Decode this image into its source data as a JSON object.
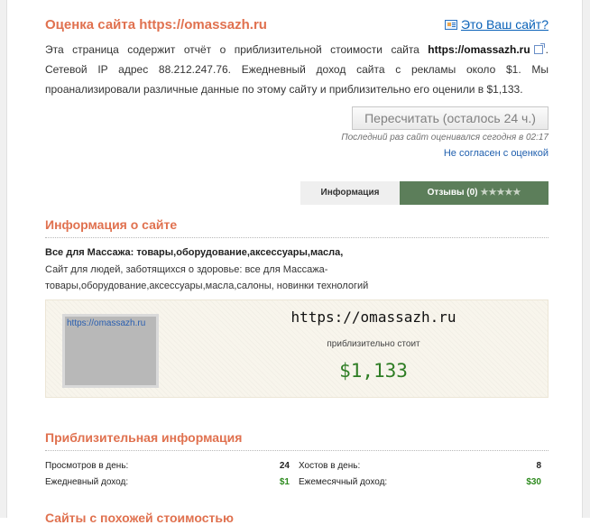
{
  "header": {
    "title": "Оценка сайта https://omassazh.ru",
    "owner_link": "Это Ваш сайт?"
  },
  "description": {
    "part1": "Эта страница содержит отчёт о приблизительной стоимости сайта ",
    "domain": "https://omassazh.ru",
    "part2": ". Сетевой IP адрес 88.212.247.76. Ежедневный доход сайта с рекламы около $1. Мы проанализировали различные данные по этому сайту и приблизительно его оценили в $1,133."
  },
  "recalc": {
    "button_label": "Пересчитать (осталось 24 ч.)",
    "last_evaluated": "Последний раз сайт оценивался сегодня в 02:17",
    "disagree_link": "Не согласен с оценкой"
  },
  "tabs": {
    "info": "Информация",
    "reviews": "Отзывы (0)",
    "stars": "★★★★★"
  },
  "site_info": {
    "section_title": "Информация о сайте",
    "name": "Все для Массажа: товары,оборудование,аксессуары,масла,",
    "description": "Сайт для людей, заботящихся о здоровье: все для Массажа- товары,оборудование,аксессуары,масла,салоны, новинки технологий"
  },
  "valuation": {
    "thumb_caption": "https://omassazh.ru",
    "domain": "https://omassazh.ru",
    "label": "приблизительно стоит",
    "price": "$1,133"
  },
  "approx": {
    "section_title": "Приблизительная информация",
    "views_label": "Просмотров в день:",
    "views_value": "24",
    "hosts_label": "Хостов в день:",
    "hosts_value": "8",
    "daily_income_label": "Ежедневный доход:",
    "daily_income_value": "$1",
    "monthly_income_label": "Ежемесячный доход:",
    "monthly_income_value": "$30"
  },
  "next_section": {
    "title": "Сайты с похожей стоимостью"
  }
}
